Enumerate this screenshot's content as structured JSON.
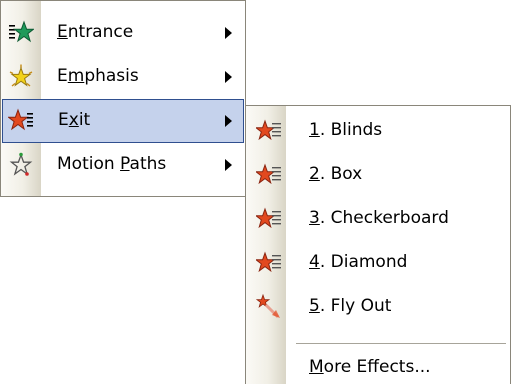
{
  "main_menu": {
    "items": [
      {
        "pre": "",
        "key": "E",
        "post": "ntrance",
        "icon": "entrance-star-icon",
        "has_submenu": true
      },
      {
        "pre": "E",
        "key": "m",
        "post": "phasis",
        "icon": "emphasis-star-icon",
        "has_submenu": true
      },
      {
        "pre": "E",
        "key": "x",
        "post": "it",
        "icon": "exit-star-icon",
        "has_submenu": true,
        "selected": true
      },
      {
        "pre": "Motion ",
        "key": "P",
        "post": "aths",
        "icon": "motion-paths-star-icon",
        "has_submenu": true
      }
    ]
  },
  "exit_submenu": {
    "items": [
      {
        "pre": "",
        "key": "1",
        "post": ". Blinds",
        "icon": "blinds-effect-icon"
      },
      {
        "pre": "",
        "key": "2",
        "post": ". Box",
        "icon": "box-effect-icon"
      },
      {
        "pre": "",
        "key": "3",
        "post": ". Checkerboard",
        "icon": "checkerboard-effect-icon"
      },
      {
        "pre": "",
        "key": "4",
        "post": ". Diamond",
        "icon": "diamond-effect-icon"
      },
      {
        "pre": "",
        "key": "5",
        "post": ". Fly Out",
        "icon": "fly-out-effect-icon"
      }
    ],
    "more": {
      "pre": "",
      "key": "M",
      "post": "ore Effects...",
      "icon": ""
    }
  },
  "colors": {
    "selection_fill": "#c5d2ec",
    "selection_border": "#2f4f8f",
    "entrance_star": "#1f9a5a",
    "emphasis_star": "#f2d21b",
    "exit_star": "#e2491f"
  }
}
